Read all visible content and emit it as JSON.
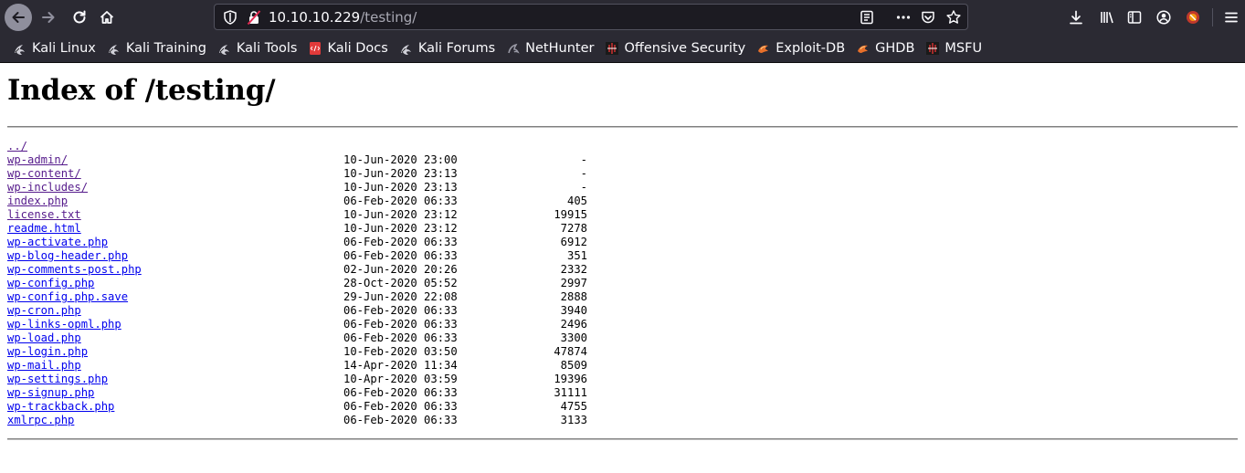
{
  "browser": {
    "url_host": "10.10.10.229",
    "url_path": "/testing/",
    "bookmarks": [
      {
        "label": "Kali Linux",
        "icon": "kali-dragon-icon"
      },
      {
        "label": "Kali Training",
        "icon": "kali-dragon-icon"
      },
      {
        "label": "Kali Tools",
        "icon": "kali-dragon-icon"
      },
      {
        "label": "Kali Docs",
        "icon": "kali-docs-icon"
      },
      {
        "label": "Kali Forums",
        "icon": "kali-dragon-icon"
      },
      {
        "label": "NetHunter",
        "icon": "nethunter-icon"
      },
      {
        "label": "Offensive Security",
        "icon": "offsec-icon"
      },
      {
        "label": "Exploit-DB",
        "icon": "exploitdb-icon"
      },
      {
        "label": "GHDB",
        "icon": "exploitdb-icon"
      },
      {
        "label": "MSFU",
        "icon": "offsec-icon"
      }
    ]
  },
  "page": {
    "title": "Index of /testing/",
    "parent_link": "../",
    "entries": [
      {
        "name": "wp-admin/",
        "date": "10-Jun-2020 23:00",
        "size": "-",
        "visited": true
      },
      {
        "name": "wp-content/",
        "date": "10-Jun-2020 23:13",
        "size": "-",
        "visited": true
      },
      {
        "name": "wp-includes/",
        "date": "10-Jun-2020 23:13",
        "size": "-",
        "visited": true
      },
      {
        "name": "index.php",
        "date": "06-Feb-2020 06:33",
        "size": "405",
        "visited": true
      },
      {
        "name": "license.txt",
        "date": "10-Jun-2020 23:12",
        "size": "19915",
        "visited": true
      },
      {
        "name": "readme.html",
        "date": "10-Jun-2020 23:12",
        "size": "7278",
        "visited": false
      },
      {
        "name": "wp-activate.php",
        "date": "06-Feb-2020 06:33",
        "size": "6912",
        "visited": false
      },
      {
        "name": "wp-blog-header.php",
        "date": "06-Feb-2020 06:33",
        "size": "351",
        "visited": false
      },
      {
        "name": "wp-comments-post.php",
        "date": "02-Jun-2020 20:26",
        "size": "2332",
        "visited": false
      },
      {
        "name": "wp-config.php",
        "date": "28-Oct-2020 05:52",
        "size": "2997",
        "visited": false
      },
      {
        "name": "wp-config.php.save",
        "date": "29-Jun-2020 22:08",
        "size": "2888",
        "visited": false
      },
      {
        "name": "wp-cron.php",
        "date": "06-Feb-2020 06:33",
        "size": "3940",
        "visited": false
      },
      {
        "name": "wp-links-opml.php",
        "date": "06-Feb-2020 06:33",
        "size": "2496",
        "visited": false
      },
      {
        "name": "wp-load.php",
        "date": "06-Feb-2020 06:33",
        "size": "3300",
        "visited": false
      },
      {
        "name": "wp-login.php",
        "date": "10-Feb-2020 03:50",
        "size": "47874",
        "visited": false
      },
      {
        "name": "wp-mail.php",
        "date": "14-Apr-2020 11:34",
        "size": "8509",
        "visited": false
      },
      {
        "name": "wp-settings.php",
        "date": "10-Apr-2020 03:59",
        "size": "19396",
        "visited": false
      },
      {
        "name": "wp-signup.php",
        "date": "06-Feb-2020 06:33",
        "size": "31111",
        "visited": false
      },
      {
        "name": "wp-trackback.php",
        "date": "06-Feb-2020 06:33",
        "size": "4755",
        "visited": false
      },
      {
        "name": "xmlrpc.php",
        "date": "06-Feb-2020 06:33",
        "size": "3133",
        "visited": false
      }
    ]
  }
}
